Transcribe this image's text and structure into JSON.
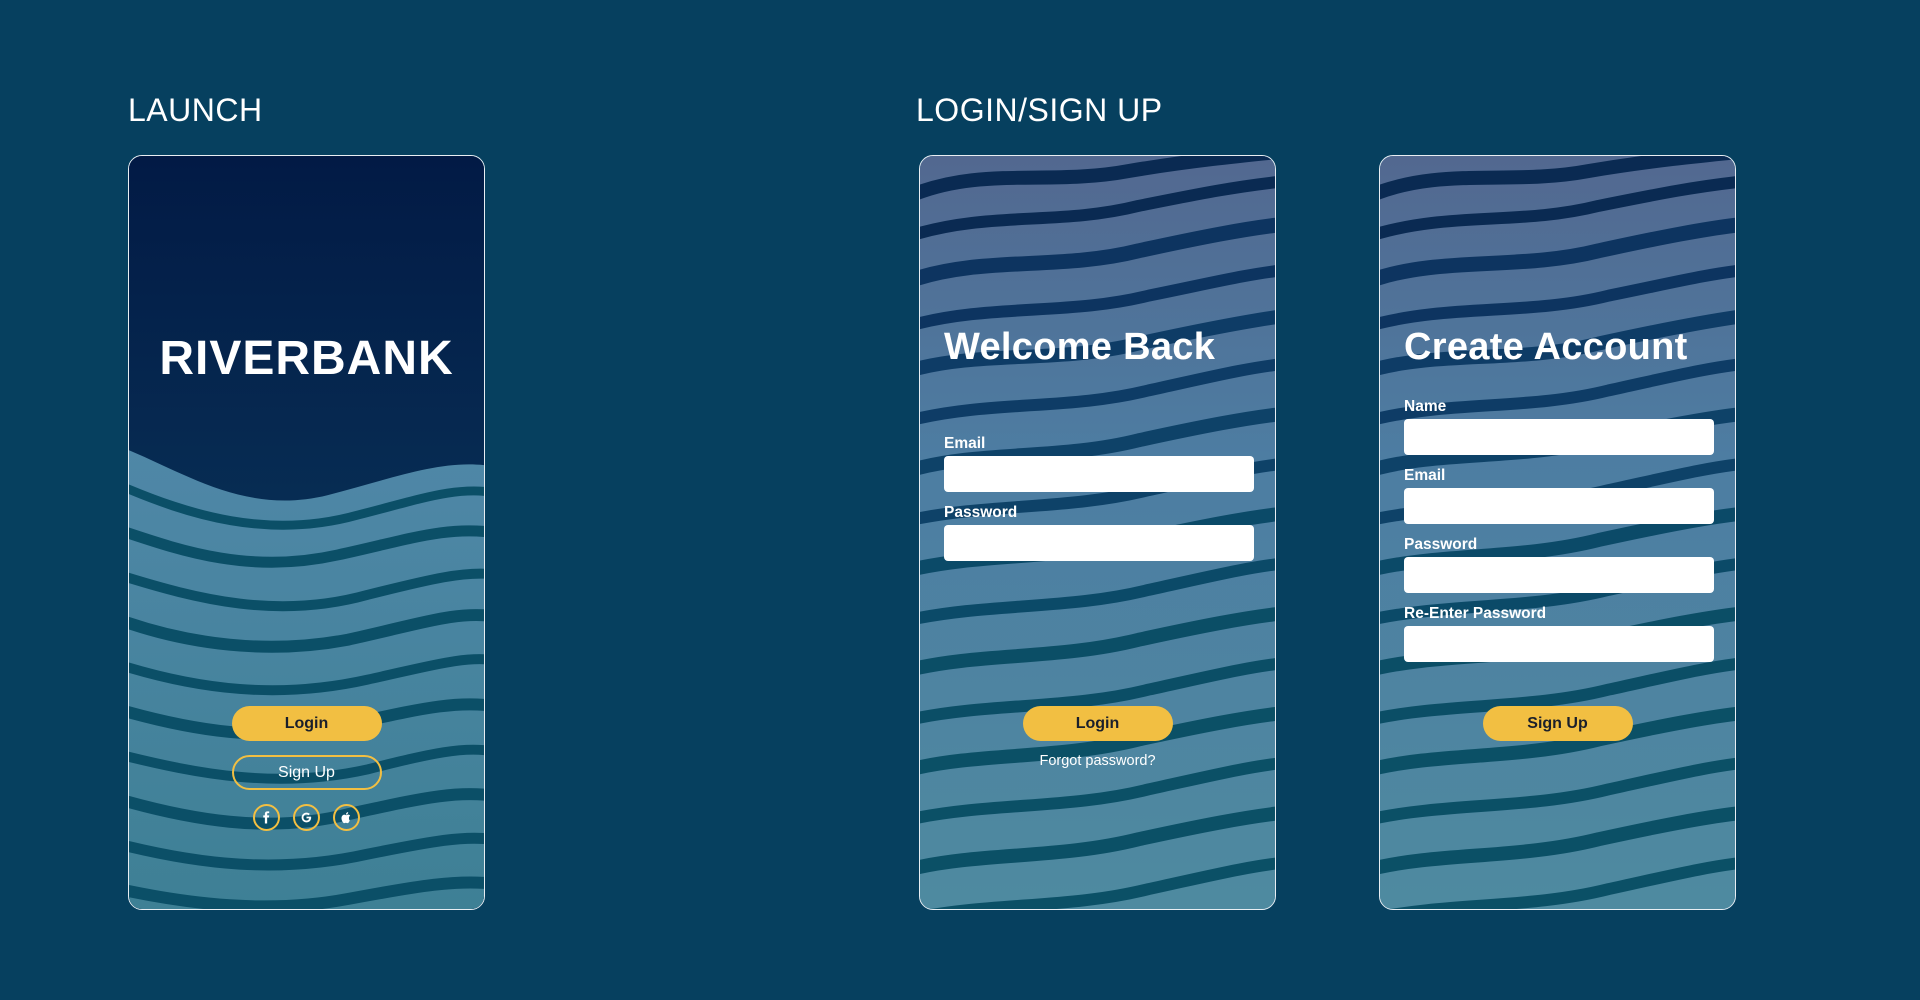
{
  "sections": {
    "launch": "LAUNCH",
    "login_signup": "LOGIN/SIGN UP"
  },
  "launch": {
    "brand": "RIVERBANK",
    "login_button": "Login",
    "signup_button": "Sign Up",
    "social": [
      "facebook-icon",
      "google-icon",
      "apple-icon"
    ]
  },
  "login": {
    "title": "Welcome Back",
    "email_label": "Email",
    "email_value": "",
    "password_label": "Password",
    "password_value": "",
    "login_button": "Login",
    "forgot_link": "Forgot password?"
  },
  "signup": {
    "title": "Create Account",
    "name_label": "Name",
    "name_value": "",
    "email_label": "Email",
    "email_value": "",
    "password_label": "Password",
    "password_value": "",
    "reenter_label": "Re-Enter Password",
    "reenter_value": "",
    "signup_button": "Sign Up"
  },
  "colors": {
    "page_background": "#06405f",
    "accent": "#f2bf42",
    "launch_top": "#021a45",
    "wave_light": "#4e86a6",
    "wave_dark": "#0b4f67"
  }
}
